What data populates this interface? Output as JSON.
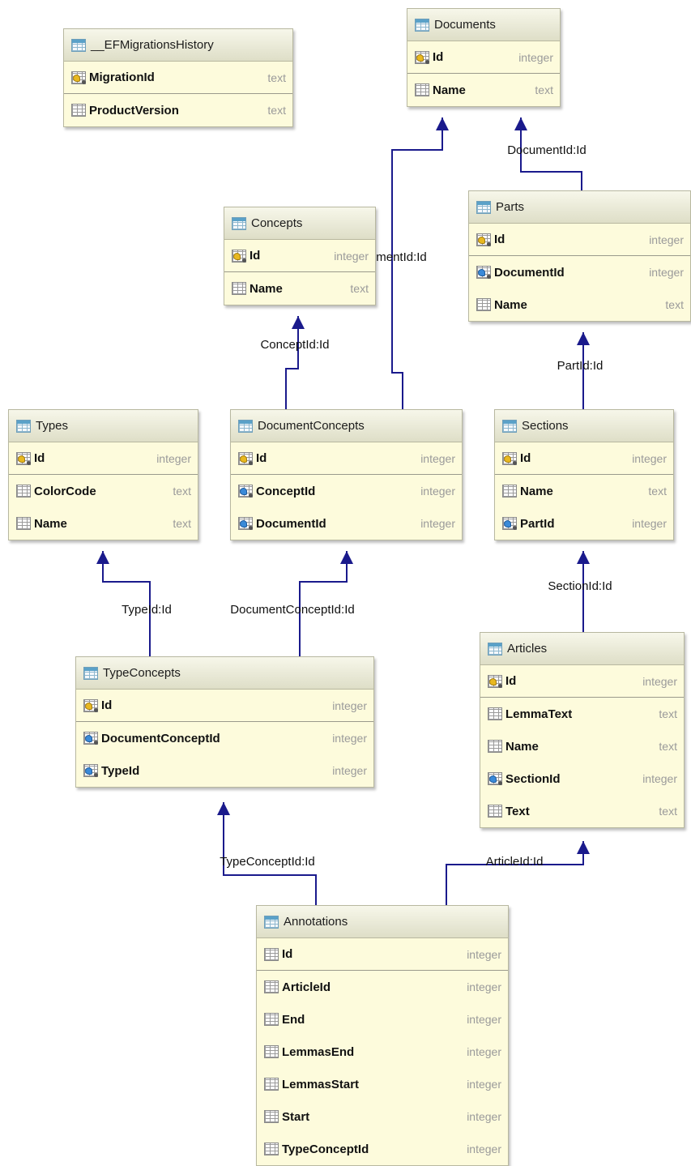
{
  "tables": [
    {
      "key": "efmig",
      "name": "__EFMigrationsHistory",
      "columns": [
        {
          "name": "MigrationId",
          "type": "text",
          "icon": "pk"
        },
        {
          "name": "ProductVersion",
          "type": "text",
          "icon": "col"
        }
      ]
    },
    {
      "key": "documents",
      "name": "Documents",
      "columns": [
        {
          "name": "Id",
          "type": "integer",
          "icon": "pk"
        },
        {
          "name": "Name",
          "type": "text",
          "icon": "col"
        }
      ]
    },
    {
      "key": "concepts",
      "name": "Concepts",
      "columns": [
        {
          "name": "Id",
          "type": "integer",
          "icon": "pk"
        },
        {
          "name": "Name",
          "type": "text",
          "icon": "col"
        }
      ]
    },
    {
      "key": "parts",
      "name": "Parts",
      "columns": [
        {
          "name": "Id",
          "type": "integer",
          "icon": "pk"
        },
        {
          "name": "DocumentId",
          "type": "integer",
          "icon": "fk"
        },
        {
          "name": "Name",
          "type": "text",
          "icon": "col"
        }
      ]
    },
    {
      "key": "types",
      "name": "Types",
      "columns": [
        {
          "name": "Id",
          "type": "integer",
          "icon": "pk"
        },
        {
          "name": "ColorCode",
          "type": "text",
          "icon": "col"
        },
        {
          "name": "Name",
          "type": "text",
          "icon": "col"
        }
      ]
    },
    {
      "key": "docconcepts",
      "name": "DocumentConcepts",
      "columns": [
        {
          "name": "Id",
          "type": "integer",
          "icon": "pk"
        },
        {
          "name": "ConceptId",
          "type": "integer",
          "icon": "fk"
        },
        {
          "name": "DocumentId",
          "type": "integer",
          "icon": "fk"
        }
      ]
    },
    {
      "key": "sections",
      "name": "Sections",
      "columns": [
        {
          "name": "Id",
          "type": "integer",
          "icon": "pk"
        },
        {
          "name": "Name",
          "type": "text",
          "icon": "col"
        },
        {
          "name": "PartId",
          "type": "integer",
          "icon": "fk"
        }
      ]
    },
    {
      "key": "typeconcepts",
      "name": "TypeConcepts",
      "columns": [
        {
          "name": "Id",
          "type": "integer",
          "icon": "pk"
        },
        {
          "name": "DocumentConceptId",
          "type": "integer",
          "icon": "fk"
        },
        {
          "name": "TypeId",
          "type": "integer",
          "icon": "fk"
        }
      ]
    },
    {
      "key": "articles",
      "name": "Articles",
      "columns": [
        {
          "name": "Id",
          "type": "integer",
          "icon": "pk"
        },
        {
          "name": "LemmaText",
          "type": "text",
          "icon": "col"
        },
        {
          "name": "Name",
          "type": "text",
          "icon": "col"
        },
        {
          "name": "SectionId",
          "type": "integer",
          "icon": "fk"
        },
        {
          "name": "Text",
          "type": "text",
          "icon": "col"
        }
      ]
    },
    {
      "key": "annotations",
      "name": "Annotations",
      "columns": [
        {
          "name": "Id",
          "type": "integer",
          "icon": "col"
        },
        {
          "name": "ArticleId",
          "type": "integer",
          "icon": "col"
        },
        {
          "name": "End",
          "type": "integer",
          "icon": "col"
        },
        {
          "name": "LemmasEnd",
          "type": "integer",
          "icon": "col"
        },
        {
          "name": "LemmasStart",
          "type": "integer",
          "icon": "col"
        },
        {
          "name": "Start",
          "type": "integer",
          "icon": "col"
        },
        {
          "name": "TypeConceptId",
          "type": "integer",
          "icon": "col"
        }
      ]
    }
  ],
  "relations": [
    {
      "key": "parts-documents",
      "label": "DocumentId:Id"
    },
    {
      "key": "docconcepts-documents",
      "label": "DocumentId:Id"
    },
    {
      "key": "docconcepts-concepts",
      "label": "ConceptId:Id"
    },
    {
      "key": "sections-parts",
      "label": "PartId:Id"
    },
    {
      "key": "typeconcepts-types",
      "label": "TypeId:Id"
    },
    {
      "key": "typeconcepts-docconcepts",
      "label": "DocumentConceptId:Id"
    },
    {
      "key": "articles-sections",
      "label": "SectionId:Id"
    },
    {
      "key": "annotations-typeconcepts",
      "label": "TypeConceptId:Id"
    },
    {
      "key": "annotations-articles",
      "label": "ArticleId:Id"
    }
  ],
  "colors": {
    "line": "#1a1a8c",
    "tableFill": "#fdfbdc",
    "header": "#dedec7",
    "pkKey": "#e8b820",
    "fkKey": "#3a8ad8"
  }
}
